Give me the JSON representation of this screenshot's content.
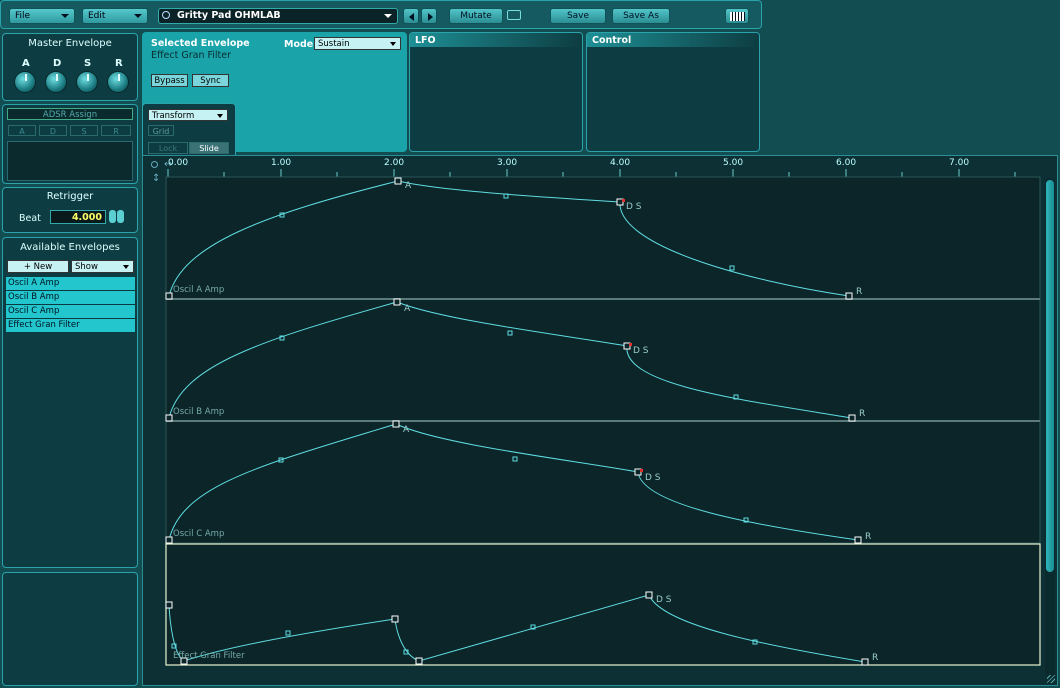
{
  "toolbar": {
    "file_label": "File",
    "edit_label": "Edit",
    "preset_name": "Gritty Pad OHMLAB",
    "mutate_label": "Mutate",
    "save_label": "Save",
    "save_as_label": "Save As"
  },
  "master_envelope": {
    "title": "Master Envelope",
    "knobs": [
      "A",
      "D",
      "S",
      "R"
    ]
  },
  "adsr_assign": {
    "title": "ADSR Assign",
    "buttons": [
      "A",
      "D",
      "S",
      "R"
    ]
  },
  "retrigger": {
    "title": "Retrigger",
    "beat_label": "Beat",
    "beat_value": "4.000"
  },
  "available_envelopes": {
    "title": "Available Envelopes",
    "new_label": "+ New",
    "show_label": "Show",
    "items": [
      "Oscil A Amp",
      "Oscil B Amp",
      "Oscil C Amp",
      "Effect Gran Filter"
    ]
  },
  "selected_envelope": {
    "title": "Selected Envelope",
    "name": "Effect Gran Filter",
    "mode_label": "Mode",
    "mode_value": "Sustain",
    "bypass_label": "Bypass",
    "sync_label": "Sync"
  },
  "tabs": {
    "lfo": "LFO",
    "control": "Control"
  },
  "transform": {
    "dropdown": "Transform",
    "grid_label": "Grid",
    "lock_label": "Lock",
    "slide_label": "Slide"
  },
  "ruler": {
    "ticks": [
      "0.00",
      "1.00",
      "2.00",
      "3.00",
      "4.00",
      "5.00",
      "6.00",
      "7.00"
    ]
  },
  "envelopes": [
    {
      "name": "Oscil A Amp",
      "labels": {
        "a": "A",
        "ds": "D S",
        "r": "R"
      }
    },
    {
      "name": "Oscil B Amp",
      "labels": {
        "a": "A",
        "ds": "D S",
        "r": "R"
      }
    },
    {
      "name": "Oscil C Amp",
      "labels": {
        "a": "A",
        "ds": "D S",
        "r": "R"
      }
    },
    {
      "name": "Effect Gran Filter",
      "labels": {
        "ds": "D S",
        "r": "R"
      }
    }
  ],
  "colors": {
    "curve": "#5fdde2",
    "selected_border": "#e8f4d0",
    "accent": "#22c6cc",
    "beat_value": "#ffff66"
  }
}
